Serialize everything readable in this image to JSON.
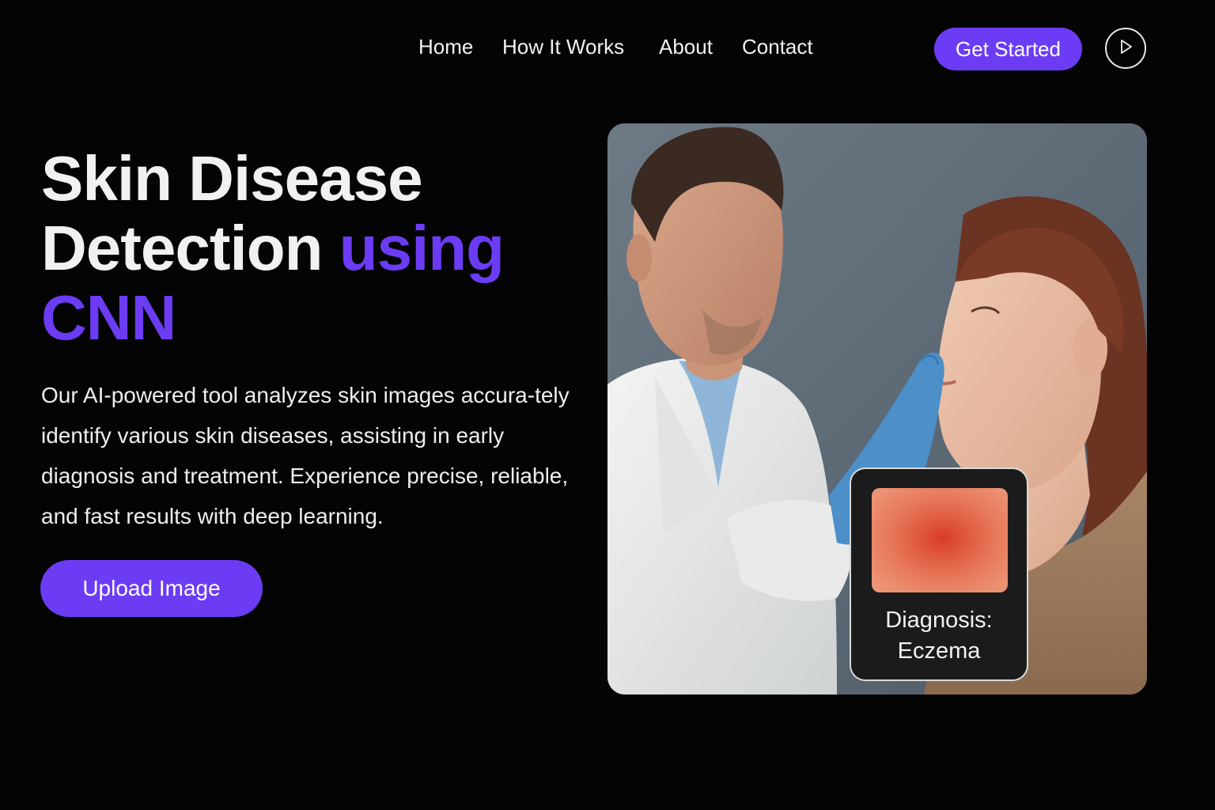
{
  "nav": {
    "items": [
      {
        "label": "Home"
      },
      {
        "label": "How It Works"
      },
      {
        "label": "About"
      },
      {
        "label": "Contact"
      }
    ],
    "cta_label": "Get Started",
    "play_icon": "play-icon"
  },
  "hero": {
    "title_line1": "Skin Disease",
    "title_line2_plain": "Detection ",
    "title_line2_accent": "using",
    "title_line3_accent": "CNN",
    "description": "Our AI-powered tool analyzes skin images accura-tely identify various skin diseases, assisting in early diagnosis and treatment. Experience precise, reliable, and fast results with deep learning.",
    "upload_label": "Upload Image"
  },
  "photo": {
    "alt_subject": "doctor-examining-patient-photo",
    "diagnosis": {
      "label_line1": "Diagnosis:",
      "label_line2": "Eczema"
    }
  },
  "colors": {
    "accent": "#6b3cf4",
    "background": "#040404",
    "text": "#f1f1f1"
  }
}
